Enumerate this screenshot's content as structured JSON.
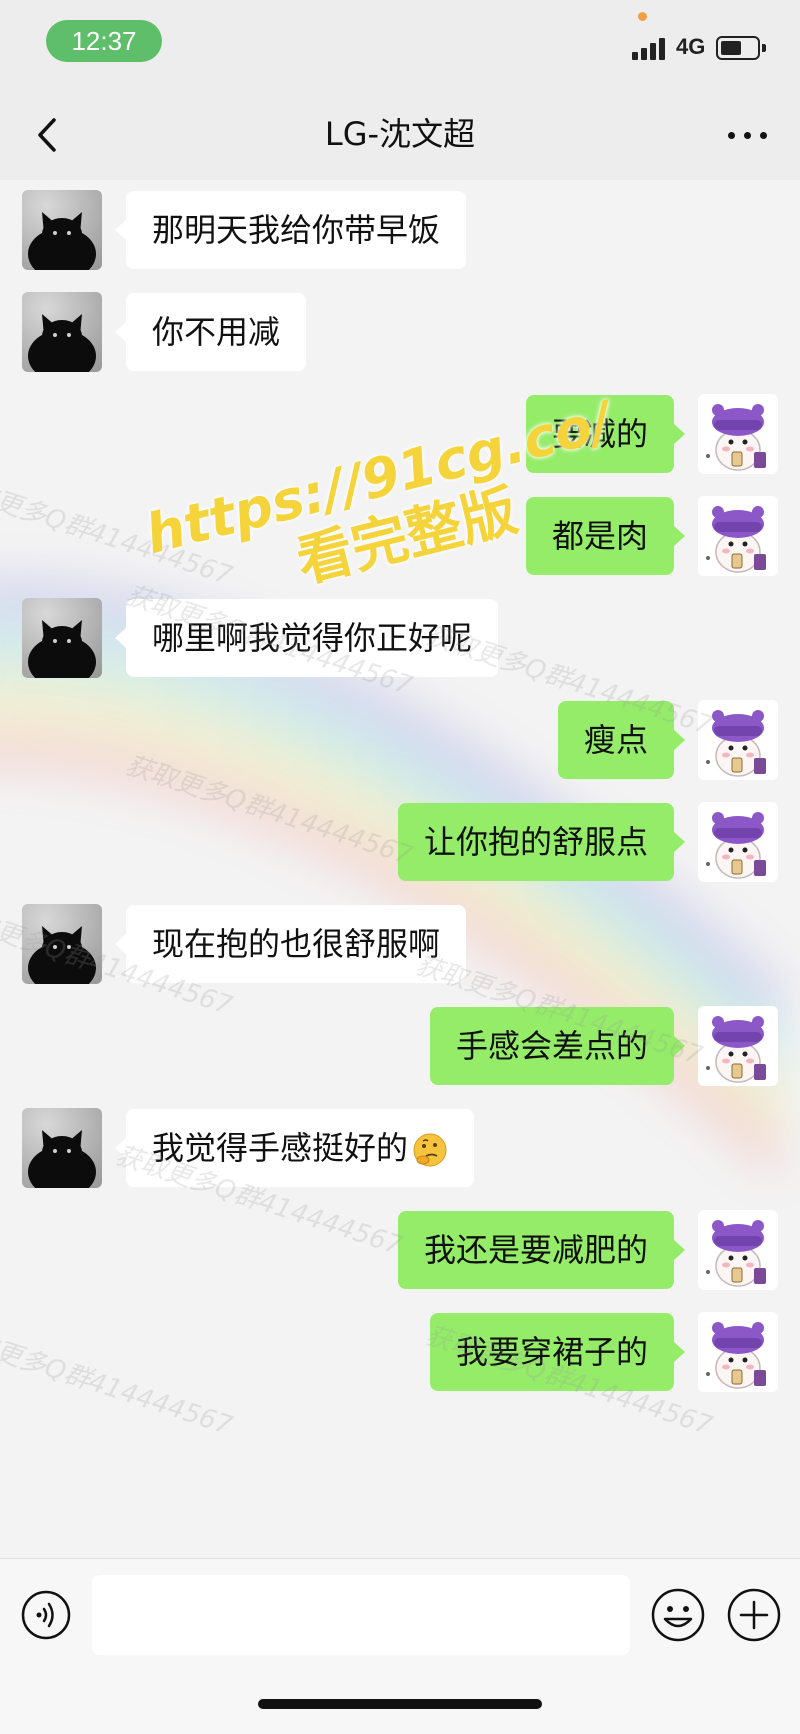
{
  "status": {
    "time": "12:37",
    "network": "4G"
  },
  "header": {
    "title": "LG-沈文超",
    "back_icon": "chevron-left-icon",
    "more_icon": "more-dots-icon"
  },
  "messages": [
    {
      "side": "left",
      "text": "那明天我给你带早饭"
    },
    {
      "side": "left",
      "text": "你不用减"
    },
    {
      "side": "right",
      "text": "要减的"
    },
    {
      "side": "right",
      "text": "都是肉"
    },
    {
      "side": "left",
      "text": "哪里啊我觉得你正好呢"
    },
    {
      "side": "right",
      "text": "瘦点"
    },
    {
      "side": "right",
      "text": "让你抱的舒服点"
    },
    {
      "side": "left",
      "text": "现在抱的也很舒服啊"
    },
    {
      "side": "right",
      "text": "手感会差点的"
    },
    {
      "side": "left",
      "text": "我觉得手感挺好的",
      "emoji": "thinking-face-icon"
    },
    {
      "side": "right",
      "text": "我还是要减肥的"
    },
    {
      "side": "right",
      "text": "我要穿裙子的"
    }
  ],
  "overlay": {
    "promo_url": "https://91cg.co/",
    "promo_sub": "看完整版",
    "watermark": "获取更多Q群414444567"
  },
  "colors": {
    "own_bubble": "#95ec69",
    "other_bubble": "#ffffff",
    "status_pill": "#5fbe6a",
    "promo": "#f5d33a"
  },
  "input": {
    "value": "",
    "icons": [
      "voice-icon",
      "emoji-icon",
      "plus-icon"
    ]
  }
}
